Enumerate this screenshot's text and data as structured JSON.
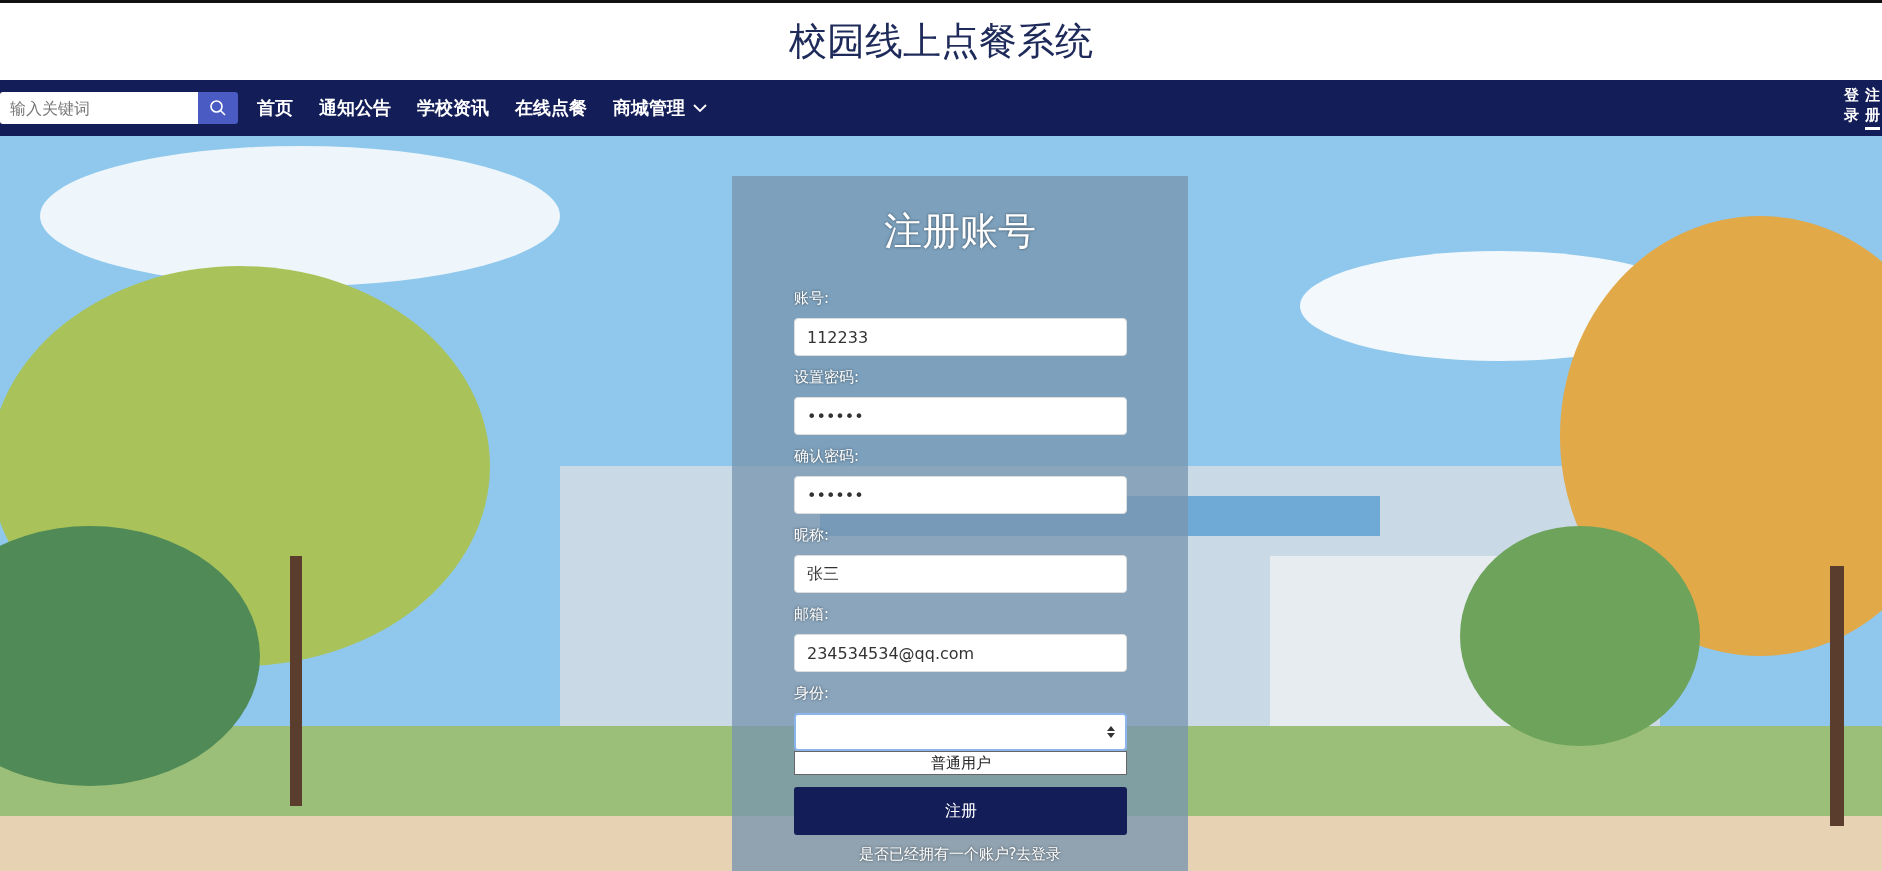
{
  "header": {
    "title": "校园线上点餐系统"
  },
  "navbar": {
    "search": {
      "placeholder": "输入关键词"
    },
    "items": [
      {
        "label": "首页",
        "dropdown": false
      },
      {
        "label": "通知公告",
        "dropdown": false
      },
      {
        "label": "学校资讯",
        "dropdown": false
      },
      {
        "label": "在线点餐",
        "dropdown": false
      },
      {
        "label": "商城管理",
        "dropdown": true
      }
    ],
    "account_links": [
      {
        "label": "登录",
        "selected": false
      },
      {
        "label": "注册",
        "selected": true
      }
    ]
  },
  "form": {
    "title": "注册账号",
    "fields": [
      {
        "kind": "text",
        "label": "账号:",
        "value": "112233"
      },
      {
        "kind": "password",
        "label": "设置密码:",
        "value": "••••••"
      },
      {
        "kind": "password",
        "label": "确认密码:",
        "value": "••••••"
      },
      {
        "kind": "text",
        "label": "昵称:",
        "value": "张三"
      },
      {
        "kind": "text",
        "label": "邮箱:",
        "value": "234534534@qq.com"
      },
      {
        "kind": "select",
        "label": "身份:",
        "open": true,
        "options": [
          {
            "label": "普通用户",
            "selected": false
          }
        ]
      }
    ],
    "submit": "注册",
    "footer_link": "是否已经拥有一个账户?去登录"
  }
}
